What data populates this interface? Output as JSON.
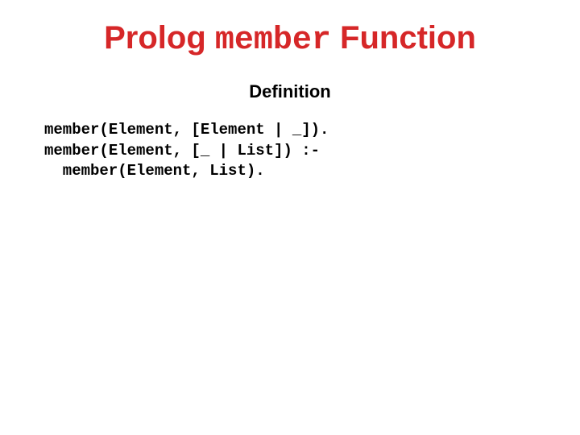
{
  "title": {
    "word1": "Prolog ",
    "word2": "member",
    "word3": " Function"
  },
  "subtitle": "Definition",
  "code": "member(Element, [Element | _]).\nmember(Element, [_ | List]) :-\n  member(Element, List)."
}
